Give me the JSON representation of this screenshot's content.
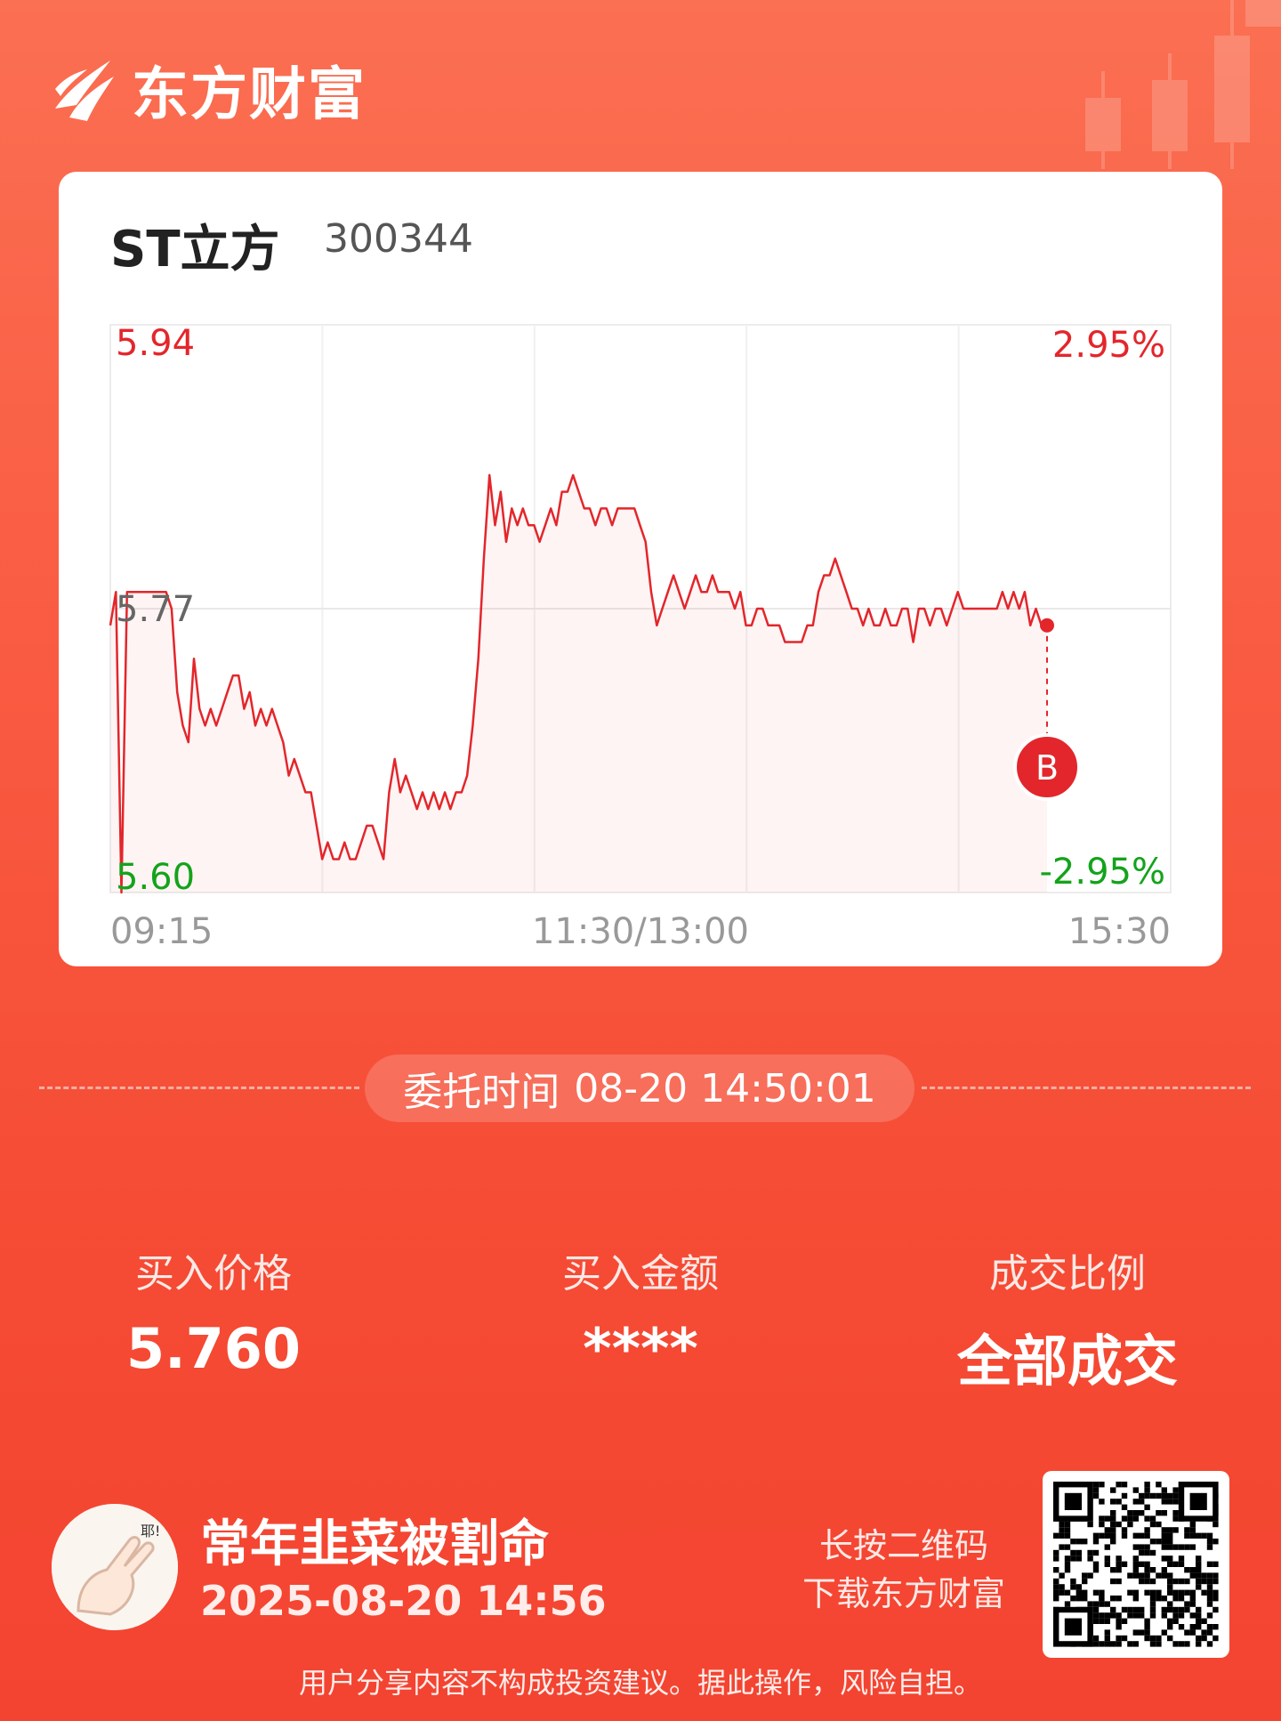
{
  "brand": {
    "name": "东方财富"
  },
  "stock": {
    "name": "ST立方",
    "code": "300344"
  },
  "chart_data": {
    "type": "line",
    "x_ticks": [
      "09:15",
      "11:30/13:00",
      "15:30"
    ],
    "y_ticks_left": [
      "5.94",
      "5.77",
      "5.60"
    ],
    "y_ticks_right": [
      "2.95%",
      "-2.95%"
    ],
    "ylim": [
      5.6,
      5.94
    ],
    "prev_close": 5.77,
    "series": [
      {
        "values": [
          5.76,
          5.78,
          5.6,
          5.78,
          5.78,
          5.78,
          5.78,
          5.78,
          5.78,
          5.78,
          5.78,
          5.77,
          5.72,
          5.7,
          5.69,
          5.74,
          5.71,
          5.7,
          5.71,
          5.7,
          5.71,
          5.72,
          5.73,
          5.73,
          5.71,
          5.72,
          5.7,
          5.71,
          5.7,
          5.71,
          5.7,
          5.69,
          5.67,
          5.68,
          5.67,
          5.66,
          5.66,
          5.64,
          5.62,
          5.63,
          5.62,
          5.62,
          5.63,
          5.62,
          5.62,
          5.63,
          5.64,
          5.64,
          5.63,
          5.62,
          5.66,
          5.68,
          5.66,
          5.67,
          5.66,
          5.65,
          5.66,
          5.65,
          5.66,
          5.65,
          5.66,
          5.65,
          5.66,
          5.66,
          5.67,
          5.7,
          5.74,
          5.8,
          5.85,
          5.82,
          5.84,
          5.81,
          5.83,
          5.82,
          5.83,
          5.82,
          5.82,
          5.81,
          5.82,
          5.83,
          5.82,
          5.84,
          5.84,
          5.85,
          5.84,
          5.83,
          5.83,
          5.82,
          5.83,
          5.83,
          5.82,
          5.83,
          5.83,
          5.83,
          5.83,
          5.82,
          5.81,
          5.78,
          5.76,
          5.77,
          5.78,
          5.79,
          5.78,
          5.77,
          5.78,
          5.79,
          5.78,
          5.78,
          5.79,
          5.78,
          5.78,
          5.78,
          5.77,
          5.78,
          5.76,
          5.76,
          5.77,
          5.77,
          5.76,
          5.76,
          5.76,
          5.75,
          5.75,
          5.75,
          5.75,
          5.76,
          5.76,
          5.78,
          5.79,
          5.79,
          5.8,
          5.79,
          5.78,
          5.77,
          5.77,
          5.76,
          5.77,
          5.76,
          5.76,
          5.77,
          5.76,
          5.76,
          5.77,
          5.77,
          5.75,
          5.77,
          5.77,
          5.76,
          5.77,
          5.77,
          5.76,
          5.77,
          5.78,
          5.77,
          5.77,
          5.77,
          5.77,
          5.77,
          5.77,
          5.77,
          5.78,
          5.77,
          5.78,
          5.77,
          5.78,
          5.76,
          5.77,
          5.76,
          5.76
        ]
      }
    ],
    "marker": {
      "label": "B",
      "value": 5.76
    }
  },
  "order": {
    "label": "委托时间",
    "time": "08-20 14:50:01"
  },
  "stats": {
    "price_label": "买入价格",
    "price_value": "5.760",
    "amount_label": "买入金额",
    "amount_value": "****",
    "ratio_label": "成交比例",
    "ratio_value": "全部成交"
  },
  "user": {
    "name": "常年韭菜被割命",
    "time": "2025-08-20 14:56",
    "avatar_caption": "耶!"
  },
  "qr": {
    "line1": "长按二维码",
    "line2": "下载东方财富"
  },
  "disclaimer": "用户分享内容不构成投资建议。据此操作，风险自担。",
  "colors": {
    "up": "#e3262b",
    "down": "#14a31b",
    "line": "#e3262b"
  }
}
